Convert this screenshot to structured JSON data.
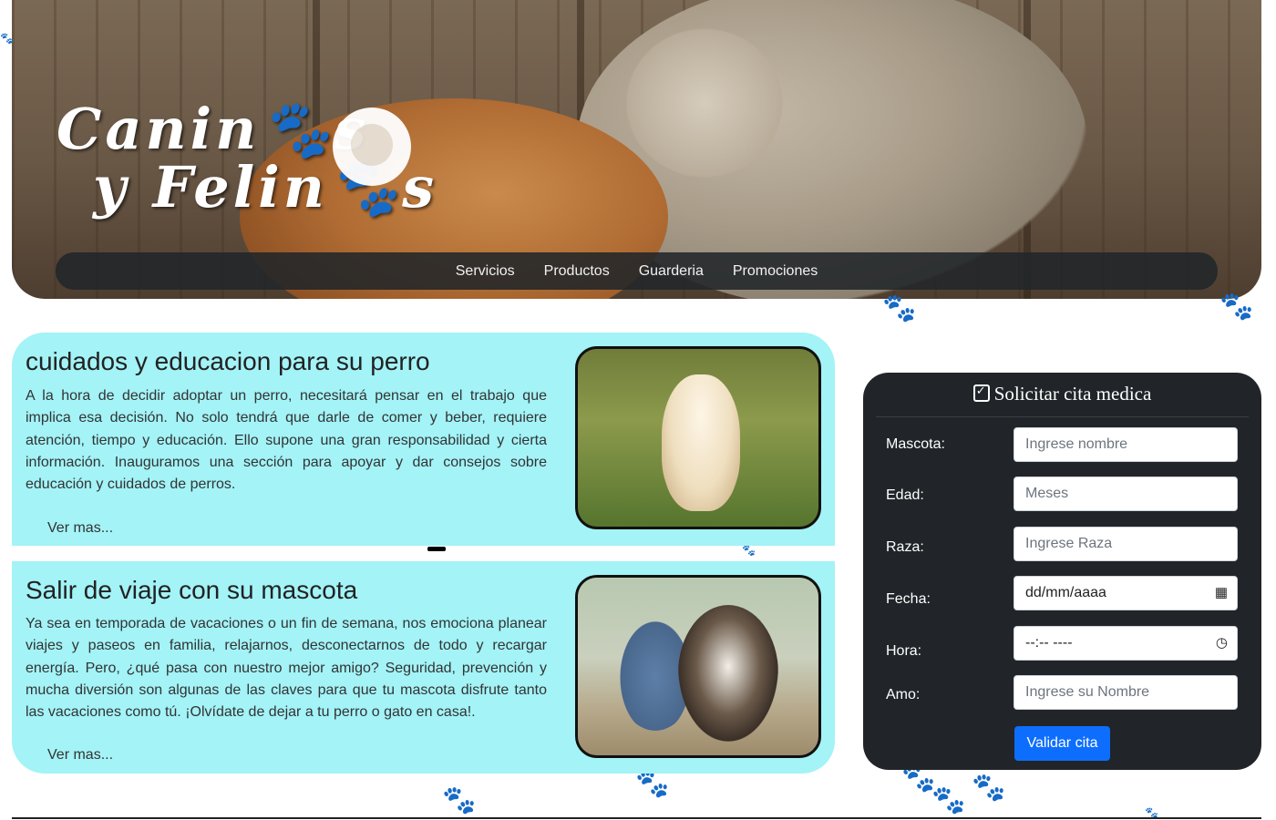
{
  "header": {
    "logo_line1": "Canin🐾s",
    "logo_line2": "y Felin🐾s",
    "nav": [
      {
        "label": "Servicios"
      },
      {
        "label": "Productos"
      },
      {
        "label": "Guarderia"
      },
      {
        "label": "Promociones"
      }
    ]
  },
  "articles": [
    {
      "title": "cuidados y educacion para su perro",
      "body": "A la hora de decidir adoptar un perro, necesitará pensar en el trabajo que implica esa decisión. No solo tendrá que darle de comer y beber, requiere atención, tiempo y educación. Ello supone una gran responsabilidad y cierta información. Inauguramos una sección para apoyar y dar consejos sobre educación y cuidados de perros.",
      "more": "Ver mas..."
    },
    {
      "title": "Salir de viaje con su mascota",
      "body": "Ya sea en temporada de vacaciones o un fin de semana, nos emociona planear viajes y paseos en familia, relajarnos, desconectarnos de todo y recargar energía. Pero, ¿qué pasa con nuestro mejor amigo? Seguridad, prevención y mucha diversión son algunas de las claves para que tu mascota disfrute tanto las vacaciones como tú. ¡Olvídate de dejar a tu perro o gato en casa!.",
      "more": "Ver mas..."
    }
  ],
  "form": {
    "title": "Solicitar cita medica",
    "fields": [
      {
        "label": "Mascota:",
        "placeholder": "Ingrese nombre"
      },
      {
        "label": "Edad:",
        "placeholder": "Meses"
      },
      {
        "label": "Raza:",
        "placeholder": "Ingrese Raza"
      },
      {
        "label": "Fecha:",
        "placeholder": "dd/mm/aaaa",
        "icon": "calendar-icon"
      },
      {
        "label": "Hora:",
        "placeholder": "--:-- ----",
        "icon": "clock-icon"
      },
      {
        "label": "Amo:",
        "placeholder": "Ingrese su Nombre"
      }
    ],
    "submit": "Validar cita"
  },
  "colors": {
    "card_bg": "#a3f3f7",
    "form_bg": "#212529",
    "nav_bg": "#212529",
    "button_bg": "#0d6efd"
  }
}
